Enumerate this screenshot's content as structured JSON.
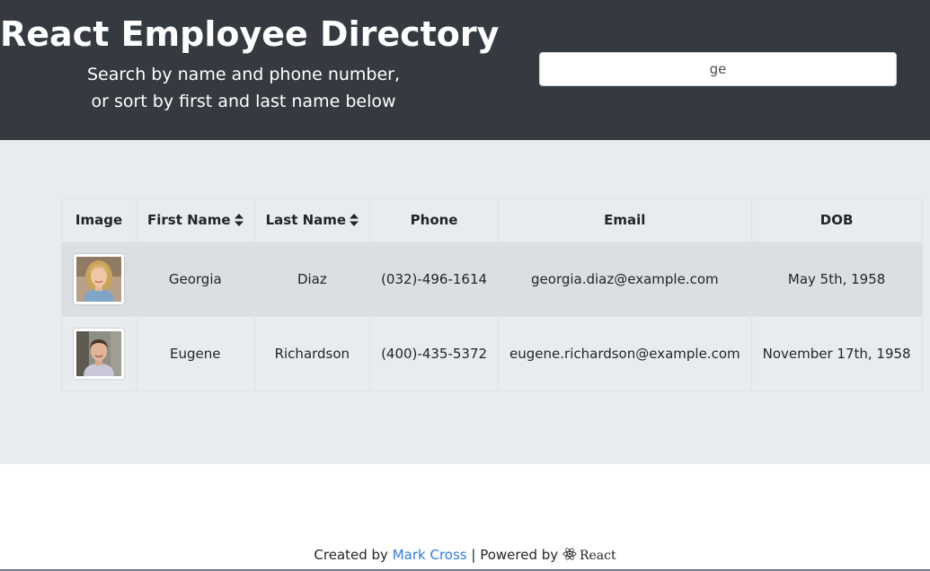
{
  "header": {
    "title": "React Employee Directory",
    "subtitle_line1": "Search by name and phone number,",
    "subtitle_line2": "or sort by first and last name below",
    "search_value": "ge"
  },
  "table": {
    "headers": {
      "image": "Image",
      "first_name": "First Name",
      "last_name": "Last Name",
      "phone": "Phone",
      "email": "Email",
      "dob": "DOB"
    },
    "rows": [
      {
        "first_name": "Georgia",
        "last_name": "Diaz",
        "phone": "(032)-496-1614",
        "email": "georgia.diaz@example.com",
        "dob": "May 5th, 1958"
      },
      {
        "first_name": "Eugene",
        "last_name": "Richardson",
        "phone": "(400)-435-5372",
        "email": "eugene.richardson@example.com",
        "dob": "November 17th, 1958"
      }
    ]
  },
  "footer": {
    "created_by": "Created by",
    "author": "Mark Cross",
    "separator": "|",
    "powered_by": "Powered by",
    "framework": "React"
  },
  "colors": {
    "header_bg": "#343a40",
    "main_bg": "#e9ecef",
    "link": "#2f7de1"
  },
  "icons": [
    "sort-icon",
    "react-logo-icon"
  ]
}
